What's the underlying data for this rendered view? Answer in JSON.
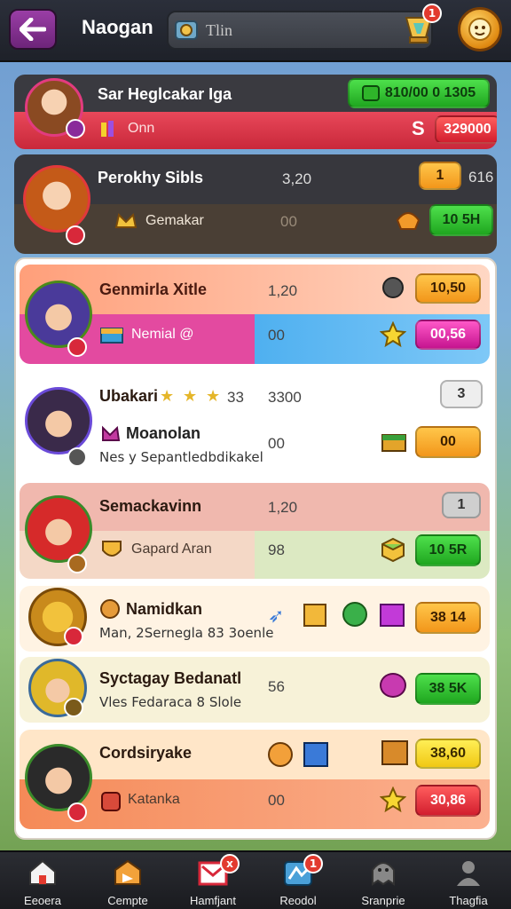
{
  "header": {
    "title": "Naogan",
    "search_value": "Tlin",
    "trophy_badge": "1"
  },
  "rows": [
    {
      "name": "Sar Heglcakar Iga",
      "sub": "Onn",
      "value_top": "810/00 0 1305",
      "value_bottom": "329000",
      "badge_letter": "S"
    },
    {
      "name": "Perokhy Sibls",
      "num_top": "3,20",
      "right_count": "1",
      "right_num": "616",
      "sub": "Gemakar",
      "num_bottom": "00",
      "pill": "10 5H"
    },
    {
      "name": "Genmirla Xitle",
      "num_top": "1,20",
      "pill_top": "10,50",
      "sub": "Nemial @",
      "num_bottom": "00",
      "pill_bottom": "00,56"
    },
    {
      "name": "Ubakari",
      "name_extra": "33",
      "num_top": "3300",
      "right_count": "3",
      "sub": "Moanolan",
      "desc": "Nes y Sepantledbdikakel",
      "num_bottom": "00",
      "pill": "00"
    },
    {
      "name": "Semackavinn",
      "num_top": "1,20",
      "right_count": "1",
      "sub": "Gapard Aran",
      "num_bottom": "98",
      "pill": "10 5R"
    },
    {
      "name": "Namidkan",
      "desc": "Man, 2Sernegla 83 3oenle",
      "pill": "38 14"
    },
    {
      "name": "Syctagay Bedanatl",
      "desc": "Vles Fedaraca 8 Slole",
      "num": "56",
      "pill": "38 5K"
    },
    {
      "name": "Cordsiryake",
      "pill_top": "38,60",
      "sub": "Katanka",
      "num_bottom": "00",
      "pill_bottom": "30,86"
    }
  ],
  "nav": [
    {
      "label": "Eeoera",
      "badge": ""
    },
    {
      "label": "Cempte",
      "badge": ""
    },
    {
      "label": "Hamfjant",
      "badge": "x"
    },
    {
      "label": "Reodol",
      "badge": "1"
    },
    {
      "label": "Sranprie",
      "badge": ""
    },
    {
      "label": "Thagfia",
      "badge": ""
    }
  ],
  "colors": {
    "accent_green": "#2fc12f",
    "accent_red": "#d8283a",
    "accent_orange": "#f5a623",
    "topbar": "#22252b"
  },
  "icons": [
    "back-arrow-icon",
    "search-icon",
    "trophy-icon",
    "coin-icon",
    "home-icon",
    "gift-icon",
    "mail-icon",
    "map-icon",
    "ghost-icon",
    "person-icon"
  ]
}
